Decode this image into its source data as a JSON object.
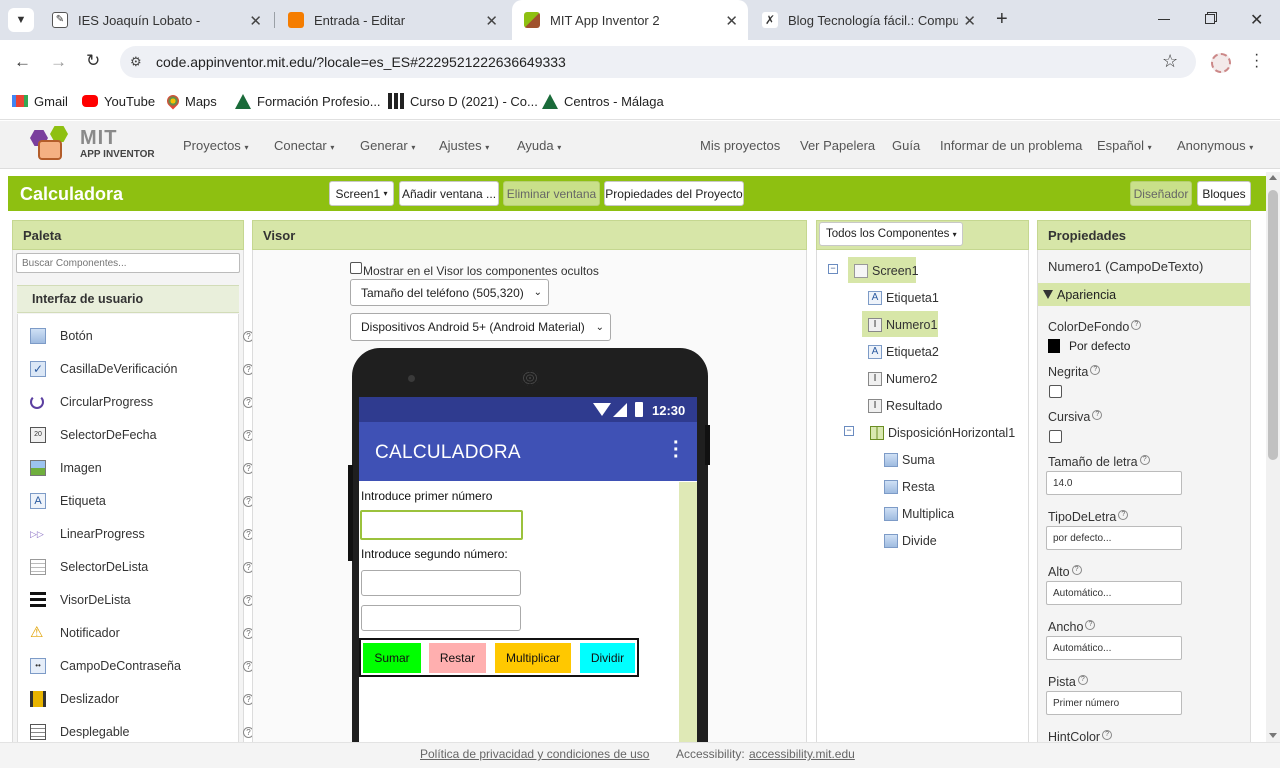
{
  "browser": {
    "tabs": [
      {
        "title": "IES Joaquín Lobato -",
        "active": false
      },
      {
        "title": "Entrada - Editar",
        "active": false
      },
      {
        "title": "MIT App Inventor 2",
        "active": true
      },
      {
        "title": "Blog Tecnología fácil.: Comput",
        "active": false
      }
    ],
    "new_tab": "+",
    "url": "code.appinventor.mit.edu/?locale=es_ES#2229521222636649333",
    "bookmarks": [
      "Gmail",
      "YouTube",
      "Maps",
      "Formación Profesio...",
      "Curso D (2021) - Co...",
      "Centros - Málaga"
    ]
  },
  "app": {
    "logo_top": "MIT",
    "logo_bottom": "APP INVENTOR",
    "menus": [
      "Proyectos",
      "Conectar",
      "Generar",
      "Ajustes",
      "Ayuda"
    ],
    "right_links": [
      "Mis proyectos",
      "Ver Papelera",
      "Guía",
      "Informar de un problema",
      "Español",
      "Anonymous"
    ],
    "project_title": "Calculadora",
    "toolbar": {
      "screen": "Screen1",
      "add_screen": "Añadir ventana ...",
      "remove_screen": "Eliminar ventana",
      "project_props": "Propiedades del Proyecto",
      "designer": "Diseñador",
      "blocks": "Bloques"
    }
  },
  "palette": {
    "title": "Paleta",
    "search_placeholder": "Buscar Componentes...",
    "section": "Interfaz de usuario",
    "items": [
      "Botón",
      "CasillaDeVerificación",
      "CircularProgress",
      "SelectorDeFecha",
      "Imagen",
      "Etiqueta",
      "LinearProgress",
      "SelectorDeLista",
      "VisorDeLista",
      "Notificador",
      "CampoDeContraseña",
      "Deslizador",
      "Desplegable"
    ],
    "help": "?"
  },
  "viewer": {
    "title": "Visor",
    "show_hidden": "Mostrar en el Visor los componentes ocultos",
    "phone_size": "Tamaño del teléfono (505,320)",
    "theme": "Dispositivos Android 5+ (Android Material)",
    "status_time": "12:30",
    "app_title": "CALCULADORA",
    "label1": "Introduce primer número",
    "label2": "Introduce segundo número:",
    "buttons": [
      {
        "label": "Sumar",
        "color": "#00ff00"
      },
      {
        "label": "Restar",
        "color": "#ffafaf"
      },
      {
        "label": "Multiplicar",
        "color": "#ffc800"
      },
      {
        "label": "Dividir",
        "color": "#00ffff"
      }
    ]
  },
  "components": {
    "dropdown": "Todos los Componentes",
    "tree": {
      "screen": "Screen1",
      "children": [
        "Etiqueta1",
        "Numero1",
        "Etiqueta2",
        "Numero2",
        "Resultado"
      ],
      "layout": "DisposiciónHorizontal1",
      "layout_children": [
        "Suma",
        "Resta",
        "Multiplica",
        "Divide"
      ]
    }
  },
  "properties": {
    "title": "Propiedades",
    "selected": "Numero1 (CampoDeTexto)",
    "section": "Apariencia",
    "bgcolor_label": "ColorDeFondo",
    "bgcolor_value": "Por defecto",
    "bold_label": "Negrita",
    "italic_label": "Cursiva",
    "fontsize_label": "Tamaño de letra",
    "fontsize_value": "14.0",
    "typeface_label": "TipoDeLetra",
    "typeface_value": "por defecto...",
    "height_label": "Alto",
    "height_value": "Automático...",
    "width_label": "Ancho",
    "width_value": "Automático...",
    "hint_label": "Pista",
    "hint_value": "Primer número",
    "hintcolor_label": "HintColor",
    "help": "?"
  },
  "footer": {
    "privacy": "Política de privacidad y condiciones de uso",
    "accessibility_label": "Accessibility:",
    "accessibility_link": "accessibility.mit.edu"
  },
  "colors": {
    "accent": "#8ec011",
    "panel_header": "#d7e6a8",
    "app_bar": "#3f51b5"
  }
}
